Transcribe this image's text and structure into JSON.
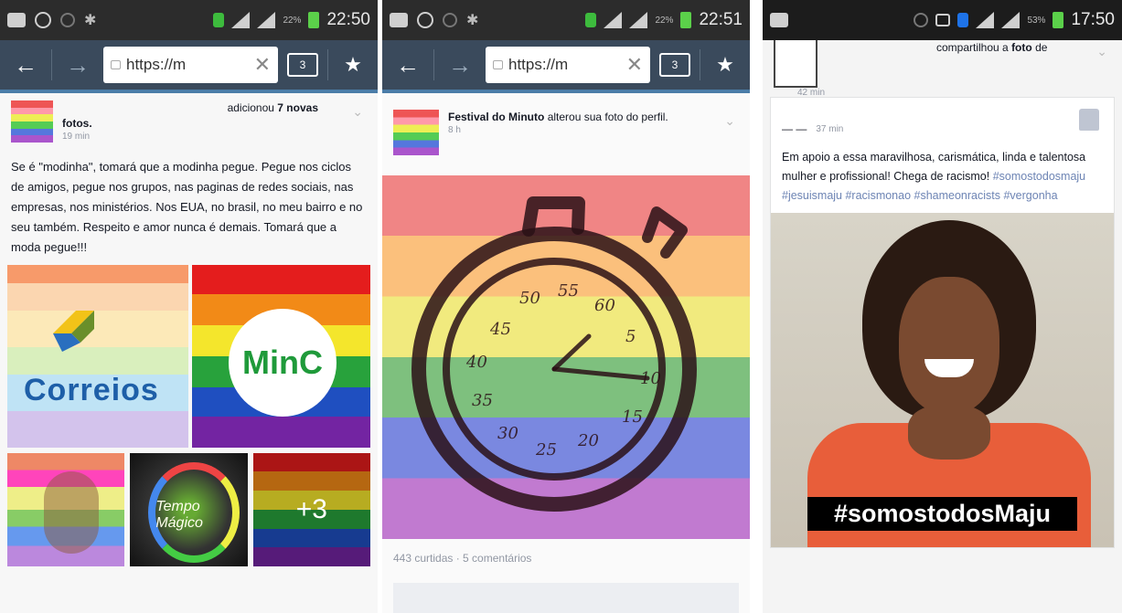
{
  "panels": [
    {
      "status": {
        "time": "22:50",
        "battery": "22%"
      },
      "browser": {
        "url": "https://m",
        "tabs_count": "3"
      },
      "post": {
        "action_prefix": "adicionou",
        "action_bold": "7 novas",
        "action_line2": "fotos.",
        "time": "19 min",
        "text": "Se é \"modinha\", tomará que a modinha pegue. Pegue nos ciclos de amigos, pegue nos grupos, nas paginas de redes sociais, nas empresas, nos ministérios. Nos EUA, no brasil, no meu bairro e no seu também. Respeito e amor nunca é demais. Tomará que a moda pegue!!!",
        "photos": {
          "correios_label": "Correios",
          "minc_label": "MinC",
          "tile4_label": "Tempo Mágico",
          "more_label": "+3"
        }
      }
    },
    {
      "status": {
        "time": "22:51",
        "battery": "22%"
      },
      "browser": {
        "url": "https://m",
        "tabs_count": "3"
      },
      "post": {
        "page_name": "Festival do Minuto",
        "action": "alterou sua foto do perfil.",
        "time": "8 h",
        "counts": "443 curtidas · 5 comentários"
      }
    },
    {
      "status": {
        "time": "17:50",
        "battery": "53%"
      },
      "prev_post": {
        "action_prefix": "compartilhou a",
        "action_bold": "foto",
        "action_suffix": "de",
        "time": "42 min"
      },
      "post": {
        "author": "— —",
        "time": "37 min",
        "text": "Em apoio a essa maravilhosa, carismática, linda e talentosa mulher e profissional! Chega de racismo!",
        "hashtags": "#somostodosmaju #jesuismaju #racismonao #shameonracists #vergonha",
        "photo_tag": "#somostodosMaju"
      }
    }
  ],
  "colors": {
    "browser_bar": "#3a4a5c",
    "statusbar": "#2c2c2c",
    "link": "#6d84b4"
  }
}
